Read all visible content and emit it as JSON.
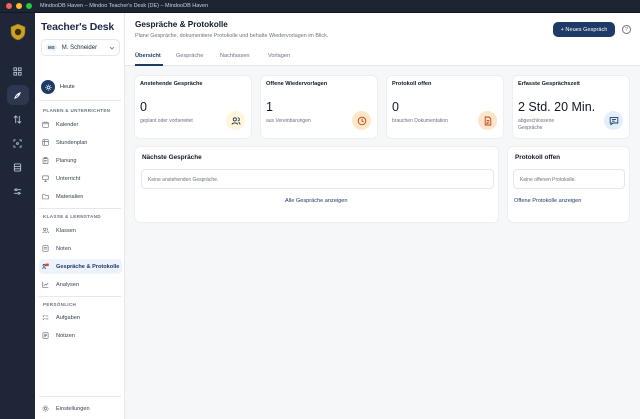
{
  "window": {
    "title": "MindooDB Haven – Mindoo Teacher's Desk (DE) – MindooDB Haven"
  },
  "brand": {
    "title": "Teacher's Desk"
  },
  "user": {
    "initials": "MS",
    "name": "M. Schneider"
  },
  "sidebar": {
    "today": "Heute",
    "sections": [
      {
        "title": "Planen & Unterrichten",
        "items": [
          "Kalender",
          "Stundenplan",
          "Planung",
          "Unterricht",
          "Materialien"
        ]
      },
      {
        "title": "Klasse & Lernstand",
        "items": [
          "Klassen",
          "Noten",
          "Gespräche & Protokolle",
          "Analysen"
        ]
      },
      {
        "title": "Persönlich",
        "items": [
          "Aufgaben",
          "Notizen"
        ]
      }
    ],
    "settings": "Einstellungen",
    "active": "Gespräche & Protokolle"
  },
  "header": {
    "title": "Gespräche & Protokolle",
    "subtitle": "Plane Gespräche, dokumentiere Protokolle und behalte Wiedervorlagen im Blick.",
    "new_button": "+ Neues Gespräch",
    "help": "?"
  },
  "tabs": [
    "Übersicht",
    "Gespräche",
    "Nachfassen",
    "Vorlagen"
  ],
  "stats": [
    {
      "title": "Anstehende Gespräche",
      "value": "0",
      "desc": "geplant oder vorbereitet",
      "icon": "users-icon",
      "color": "#fdf6dd",
      "stroke": "#1f2937"
    },
    {
      "title": "Offene Wiedervorlagen",
      "value": "1",
      "desc": "aus Vereinbarungen",
      "icon": "clock-icon",
      "color": "#fde7c8",
      "stroke": "#c2410c"
    },
    {
      "title": "Protokoll offen",
      "value": "0",
      "desc": "brauchen Dokumentation",
      "icon": "document-icon",
      "color": "#fde4cc",
      "stroke": "#c2410c"
    },
    {
      "title": "Erfasste Gesprächszeit",
      "value": "2 Std. 20 Min.",
      "desc": "abgeschlossene Gespräche",
      "icon": "chat-icon",
      "color": "#e3eefb",
      "stroke": "#1e3a66"
    }
  ],
  "upcoming": {
    "title": "Nächste Gespräche",
    "empty": "Keine anstehenden Gespräche.",
    "link": "Alle Gespräche anzeigen"
  },
  "protocol": {
    "title": "Protokoll offen",
    "empty": "Keine offenen Protokolle.",
    "link": "Offene Protokolle anzeigen"
  }
}
